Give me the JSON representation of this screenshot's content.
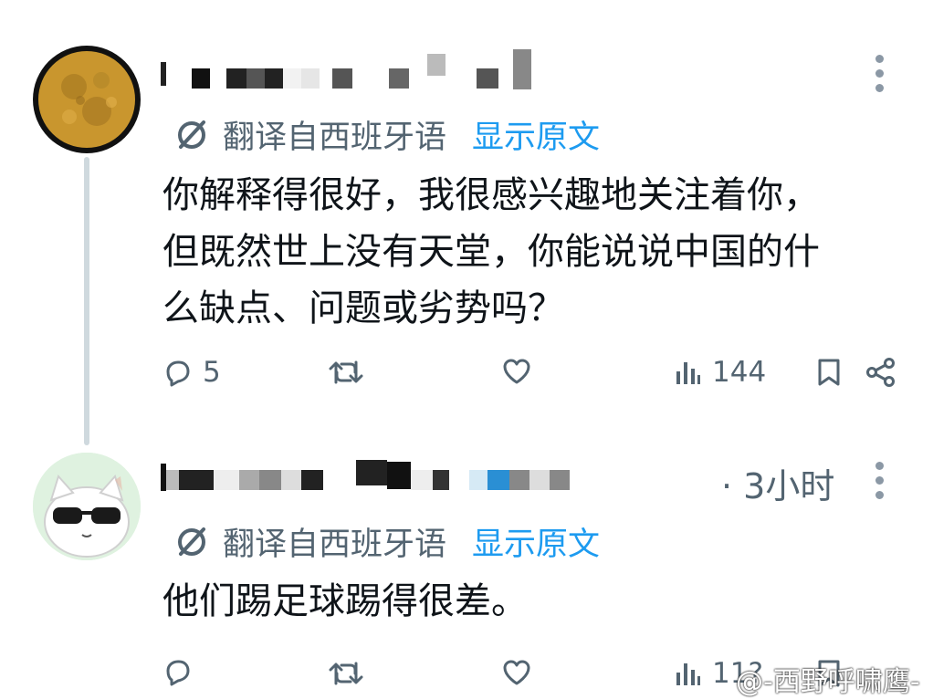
{
  "tweets": [
    {
      "translate_label": "翻译自西班牙语",
      "show_original": "显示原文",
      "text": "你解释得很好，我很感兴趣地关注着你，\n但既然世上没有天堂，你能说说中国的什\n么缺点、问题或劣势吗？",
      "replies": "5",
      "views": "144"
    },
    {
      "time": "· 3小时",
      "translate_label": "翻译自西班牙语",
      "show_original": "显示原文",
      "text": "他们踢足球踢得很差。",
      "views": "11?"
    }
  ],
  "watermark": "@-西野呼啸鹰-",
  "icons": {
    "translate": "translate-icon",
    "reply": "reply-icon",
    "retweet": "retweet-icon",
    "like": "like-icon",
    "views": "views-icon",
    "bookmark": "bookmark-icon",
    "share": "share-icon",
    "more": "more-icon"
  },
  "colors": {
    "accent": "#1d9bf0",
    "muted": "#536471",
    "text": "#0f1419"
  }
}
